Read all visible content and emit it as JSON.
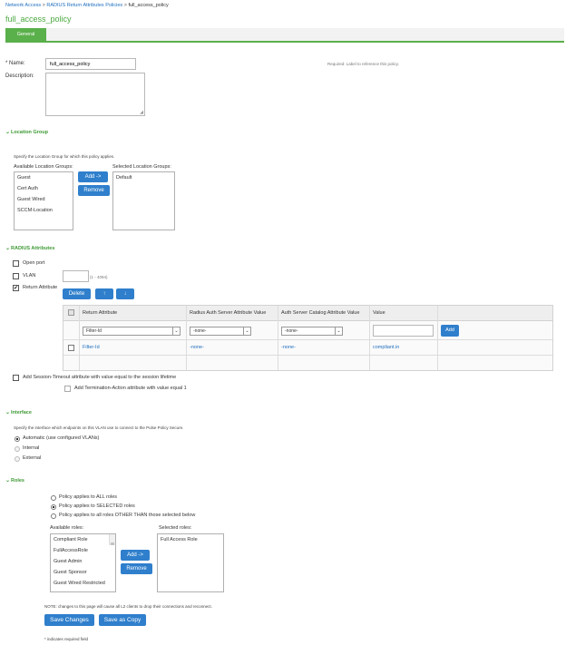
{
  "breadcrumb": {
    "items": [
      "Network Access",
      "RADIUS Return Attributes Policies"
    ],
    "separator": ">",
    "current": "full_access_policy"
  },
  "page_title": "full_access_policy",
  "tabs": [
    {
      "label": "General",
      "active": true
    }
  ],
  "form": {
    "name_label": "* Name:",
    "name_value": "full_access_policy",
    "name_hint": "Required: Label to reference this policy.",
    "description_label": "Description:",
    "description_value": ""
  },
  "location_group": {
    "heading": "Location Group",
    "help": "Specify the Location Group for which this policy applies.",
    "available_label": "Available Location Groups:",
    "available": [
      "Guest",
      "Cert Auth",
      "Guest Wired",
      "SCCM-Location"
    ],
    "selected_label": "Selected Location Groups:",
    "selected": [
      "Default"
    ],
    "add_label": "Add ->",
    "remove_label": "Remove"
  },
  "radius_attributes": {
    "heading": "RADIUS Attributes",
    "open_port_label": "Open port",
    "open_port_checked": false,
    "vlan_label": "VLAN",
    "vlan_checked": false,
    "vlan_value": "",
    "vlan_range": "(1 - 4094)",
    "return_attribute_label": "Return Attribute",
    "return_attribute_checked": true,
    "delete_label": "Delete",
    "up_arrow": "↑",
    "down_arrow": "↓",
    "table": {
      "columns": [
        "Return Attribute",
        "Radius Auth Server Attribute Value",
        "Auth Server Catalog Attribute Value",
        "Value"
      ],
      "new_row": {
        "return_attribute": "Filter-Id",
        "radius_auth": "-none-",
        "catalog": "-none-",
        "value": "",
        "add_label": "Add"
      },
      "rows": [
        {
          "return_attribute": "Filter-Id",
          "radius_auth": "-none-",
          "catalog": "-none-",
          "value": "compliant.in",
          "checked": false
        }
      ]
    },
    "session_timeout_label": "Add Session-Timeout attribute with value equal to the session lifetime",
    "session_timeout_checked": false,
    "termination_action_label": "Add Termination-Action attribute with value equal 1",
    "termination_action_checked": false
  },
  "interface": {
    "heading": "Interface",
    "help": "Specify the interface which endpoints on this VLAN use to connect to the Pulse Policy Secure.",
    "options": [
      {
        "label": "Automatic (use configured VLANs)",
        "selected": true
      },
      {
        "label": "Internal",
        "selected": false
      },
      {
        "label": "External",
        "selected": false
      }
    ]
  },
  "roles": {
    "heading": "Roles",
    "options": [
      {
        "label": "Policy applies to ALL roles",
        "selected": false
      },
      {
        "label": "Policy applies to SELECTED roles",
        "selected": true
      },
      {
        "label": "Policy applies to all roles OTHER THAN those selected below",
        "selected": false
      }
    ],
    "available_label": "Available roles:",
    "available": [
      "Compliant Role",
      "FullAccessRole",
      "Guest Admin",
      "Guest Sponsor",
      "Guest Wired Restricted"
    ],
    "selected_label": "Selected roles:",
    "selected": [
      "Full Access Role"
    ],
    "add_label": "Add ->",
    "remove_label": "Remove"
  },
  "note": "NOTE: changes to this page will cause all L2 clients to drop their connections and reconnect.",
  "save_changes_label": "Save Changes",
  "save_as_copy_label": "Save as Copy",
  "required_note": "* indicates required field",
  "colors": {
    "accent_green": "#5ab04a",
    "link_blue": "#1f6fbf",
    "button_blue": "#2f7fcc"
  }
}
